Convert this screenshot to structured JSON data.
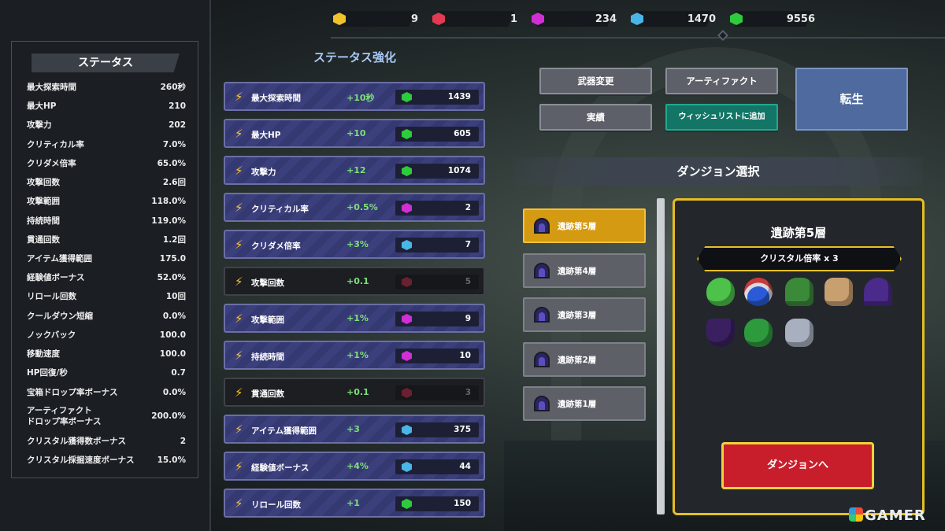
{
  "currency": [
    {
      "icon": "gold-gem-icon",
      "color": "#f2c22a",
      "value": "9"
    },
    {
      "icon": "red-gem-icon",
      "color": "#e23a52",
      "value": "1"
    },
    {
      "icon": "purple-gem-icon",
      "color": "#d02fd6",
      "value": "234"
    },
    {
      "icon": "blue-gem-icon",
      "color": "#4ab6e8",
      "value": "1470"
    },
    {
      "icon": "green-gem-icon",
      "color": "#2ecb3c",
      "value": "9556"
    }
  ],
  "status": {
    "title": "ステータス",
    "rows": [
      {
        "name": "最大探索時間",
        "value": "260秒"
      },
      {
        "name": "最大HP",
        "value": "210"
      },
      {
        "name": "攻撃力",
        "value": "202"
      },
      {
        "name": "クリティカル率",
        "value": "7.0%"
      },
      {
        "name": "クリダメ倍率",
        "value": "65.0%"
      },
      {
        "name": "攻撃回数",
        "value": "2.6回"
      },
      {
        "name": "攻撃範囲",
        "value": "118.0%"
      },
      {
        "name": "持続時間",
        "value": "119.0%"
      },
      {
        "name": "貫通回数",
        "value": "1.2回"
      },
      {
        "name": "アイテム獲得範囲",
        "value": "175.0"
      },
      {
        "name": "経験値ボーナス",
        "value": "52.0%"
      },
      {
        "name": "リロール回数",
        "value": "10回"
      },
      {
        "name": "クールダウン短縮",
        "value": "0.0%"
      },
      {
        "name": "ノックバック",
        "value": "100.0"
      },
      {
        "name": "移動速度",
        "value": "100.0"
      },
      {
        "name": "HP回復/秒",
        "value": "0.7"
      },
      {
        "name": "宝箱ドロップ率ボーナス",
        "value": "0.0%"
      },
      {
        "name": "アーティファクト",
        "name2": "ドロップ率ボーナス",
        "value": "200.0%"
      },
      {
        "name": "クリスタル獲得数ボーナス",
        "value": "2"
      },
      {
        "name": "クリスタル採掘速度ボーナス",
        "value": "15.0%"
      }
    ]
  },
  "upgrade": {
    "title": "ステータス強化",
    "items": [
      {
        "label": "最大探索時間",
        "inc": "+10秒",
        "gem": "#2ecb3c",
        "cost": "1439",
        "enabled": true
      },
      {
        "label": "最大HP",
        "inc": "+10",
        "gem": "#2ecb3c",
        "cost": "605",
        "enabled": true
      },
      {
        "label": "攻撃力",
        "inc": "+12",
        "gem": "#2ecb3c",
        "cost": "1074",
        "enabled": true
      },
      {
        "label": "クリティカル率",
        "inc": "+0.5%",
        "gem": "#d02fd6",
        "cost": "2",
        "enabled": true
      },
      {
        "label": "クリダメ倍率",
        "inc": "+3%",
        "gem": "#4ab6e8",
        "cost": "7",
        "enabled": true
      },
      {
        "label": "攻撃回数",
        "inc": "+0.1",
        "gem": "#6a2030",
        "cost": "5",
        "enabled": false
      },
      {
        "label": "攻撃範囲",
        "inc": "+1%",
        "gem": "#d02fd6",
        "cost": "9",
        "enabled": true
      },
      {
        "label": "持続時間",
        "inc": "+1%",
        "gem": "#d02fd6",
        "cost": "10",
        "enabled": true
      },
      {
        "label": "貫通回数",
        "inc": "+0.1",
        "gem": "#6a2030",
        "cost": "3",
        "enabled": false
      },
      {
        "label": "アイテム獲得範囲",
        "inc": "+3",
        "gem": "#4ab6e8",
        "cost": "375",
        "enabled": true
      },
      {
        "label": "経験値ボーナス",
        "inc": "+4%",
        "gem": "#4ab6e8",
        "cost": "44",
        "enabled": true
      },
      {
        "label": "リロール回数",
        "inc": "+1",
        "gem": "#2ecb3c",
        "cost": "150",
        "enabled": true
      }
    ]
  },
  "buttons": {
    "weapon": "武器変更",
    "artifact": "アーティファクト",
    "achievements": "実績",
    "wishlist": "ウィッシュリストに追加",
    "rebirth": "転生"
  },
  "dungeon": {
    "title": "ダンジョン選択",
    "floors": [
      "遺跡第5層",
      "遺跡第4層",
      "遺跡第3層",
      "遺跡第2層",
      "遺跡第1層"
    ],
    "selected_index": 0,
    "card_title": "遺跡第5層",
    "bonus": "クリスタル倍率 x 3",
    "monsters": [
      "green-slime-icon",
      "spiked-shell-icon",
      "green-turtle-icon",
      "skeleton-warrior-icon",
      "purple-mage-icon",
      "dark-bat-icon",
      "green-plant-icon",
      "armored-knight-icon"
    ],
    "enter": "ダンジョンへ"
  },
  "watermark": "GAMER"
}
